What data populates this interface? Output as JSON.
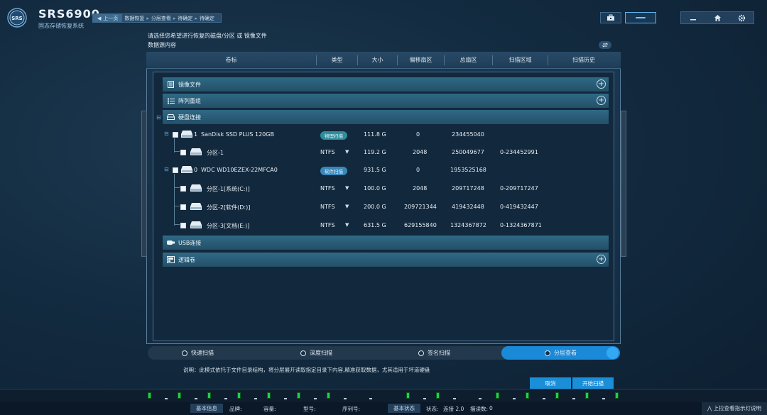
{
  "app": {
    "name": "SRS6900",
    "subtitle": "固态存储恢复系统",
    "logo_text": "SRS"
  },
  "breadcrumb": {
    "back_label": "上一页",
    "items": [
      "数据恢复",
      "分层查看",
      "待确定",
      "待确定"
    ]
  },
  "instructions": {
    "prompt": "请选择您希望进行恢复的磁盘/分区 或 镜像文件",
    "source_label": "数据源内容"
  },
  "columns": [
    "卷标",
    "类型",
    "大小",
    "偏移扇区",
    "总扇区",
    "扫描区域",
    "扫描历史"
  ],
  "groups": {
    "image_files": "镜像文件",
    "array_reorg": "阵列重组",
    "disk_connect": "硬盘连接",
    "usb_connect": "USB连接",
    "logical_volume": "逻辑卷"
  },
  "disks": [
    {
      "index": "1",
      "name": "SanDisk SSD PLUS 120GB",
      "tag": "物理扫描",
      "size": "111.8 G",
      "offset": "0",
      "total": "234455040",
      "partitions": [
        {
          "label": "分区-1",
          "type": "NTFS",
          "size": "119.2 G",
          "offset": "2048",
          "total": "250049677",
          "range": "0-234452991"
        }
      ]
    },
    {
      "index": "0",
      "name": "WDC WD10EZEX-22MFCA0",
      "tag": "软件扫描",
      "size": "931.5 G",
      "offset": "0",
      "total": "1953525168",
      "partitions": [
        {
          "label": "分区-1[系统(C:)]",
          "type": "NTFS",
          "size": "100.0 G",
          "offset": "2048",
          "total": "209717248",
          "range": "0-209717247"
        },
        {
          "label": "分区-2[软件(D:)]",
          "type": "NTFS",
          "size": "200.0 G",
          "offset": "209721344",
          "total": "419432448",
          "range": "0-419432447"
        },
        {
          "label": "分区-3[文档(E:)]",
          "type": "NTFS",
          "size": "631.5 G",
          "offset": "629155840",
          "total": "1324367872",
          "range": "0-1324367871"
        }
      ]
    }
  ],
  "scan_modes": {
    "quick": "快速扫描",
    "deep": "深度扫描",
    "signature": "签名扫描",
    "layered": "分层查看",
    "selected": "分层查看"
  },
  "note": "说明：此模式依托于文件目录结构，将分层展开读取指定目录下内容,精准获取数据，尤其适用于坏道硬盘",
  "buttons": {
    "cancel": "取消",
    "start": "开始扫描"
  },
  "status_bar": {
    "tab_basic": "基本信息",
    "brand_label": "品牌:",
    "capacity_label": "容量:",
    "model_label": "型号:",
    "serial_label": "序列号:",
    "tab_status": "基本状态",
    "state_label": "状态:",
    "state_value": "连接 2.0",
    "scan_count_label": "描读数:",
    "scan_count_value": "0",
    "help": "上拉查看指示灯说明"
  },
  "colors": {
    "accent": "#1a8ad8",
    "group_bar": "#2f6a86",
    "led_on": "#22d04a",
    "tag_physical": "#2f8c9a",
    "tag_software": "#3a87b9"
  }
}
